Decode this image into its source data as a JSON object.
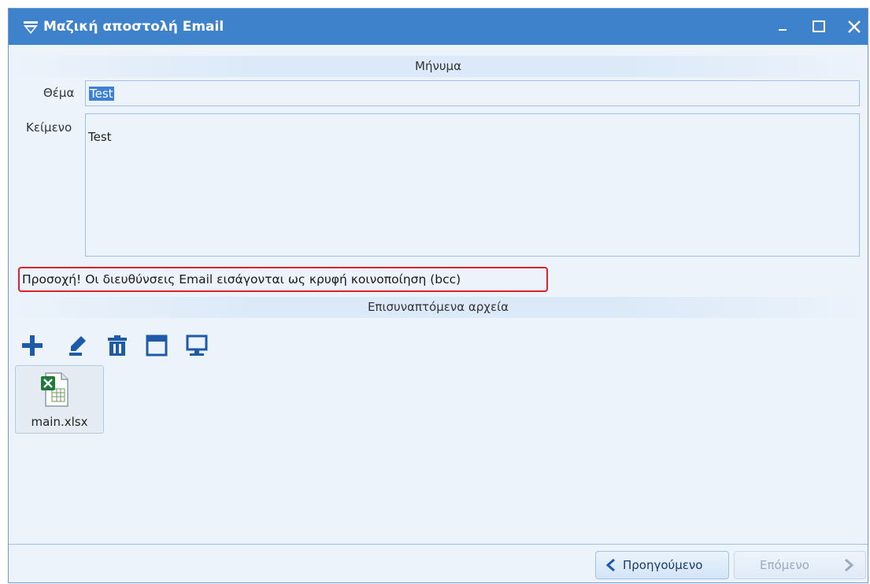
{
  "window": {
    "title": "Μαζική αποστολή Email",
    "accent_color": "#3f82cc"
  },
  "message_section": {
    "header": "Μήνυμα",
    "subject_label": "Θέμα",
    "subject_value": "Test",
    "body_label": "Κείμενο",
    "body_value": "Test"
  },
  "warning": {
    "text": "Προσοχή! Οι διευθύνσεις Email εισάγονται ως κρυφή κοινοποίηση  (bcc)",
    "border_color": "#e0202d"
  },
  "attachments_section": {
    "header": "Επισυναπτόμενα αρχεία",
    "toolbar_icons": [
      "add-icon",
      "edit-icon",
      "delete-icon",
      "window-icon",
      "screen-icon"
    ],
    "files": [
      {
        "name": "main.xlsx",
        "icon": "excel-file-icon"
      }
    ]
  },
  "footer": {
    "prev_label": "Προηγούμενο",
    "next_label": "Επόμενο"
  }
}
